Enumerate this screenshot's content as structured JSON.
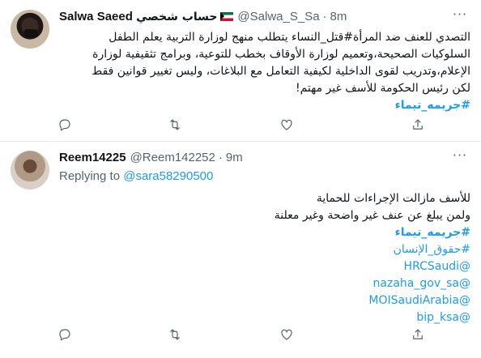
{
  "tweets": [
    {
      "name": "Salwa Saeed حساب شخصي",
      "handle": "@Salwa_S_Sa",
      "time": "8m",
      "lines": [
        "التصدي للعنف ضد المرأة#قتل_النساء يتطلب منهج لوزارة التربية يعلم الطفل",
        "السلوكيات الصحيحة،وتعميم لوزارة الأوقاف بخطب للتوعية، وبرامج تثقيفية لوزارة",
        "الإعلام،وتدريب لقوى الداخلية لكيفية التعامل مع البلاغات، وليس تغيير قوانين فقط",
        "لكن رئيس الحكومة للأسف غير مهتم!"
      ],
      "hashtag": "#جريمه_تيماء"
    },
    {
      "name": "Reem14225",
      "handle": "@Reem142252",
      "time": "9m",
      "replying_label": "Replying to",
      "replying_to": "@sara58290500",
      "lines": [
        "للأسف مازالت الإجراءات للحماية",
        "ولمن يبلغ عن عنف غير واضحة وغير معلنة"
      ],
      "hashtag": "#جريمه_تيماء",
      "links": [
        "#حقوق_الإنسان",
        "@HRCSaudi",
        "@nazaha_gov_sa",
        "@MOISaudiArabia",
        "@bip_ksa"
      ]
    }
  ],
  "dot": "·",
  "more_icon": "···",
  "icons": [
    "reply-icon",
    "retweet-icon",
    "like-icon",
    "share-icon"
  ],
  "colors": {
    "accent": "#1d9bf0",
    "muted": "#536471",
    "text": "#0f1419",
    "divider": "#e6ecf0"
  }
}
